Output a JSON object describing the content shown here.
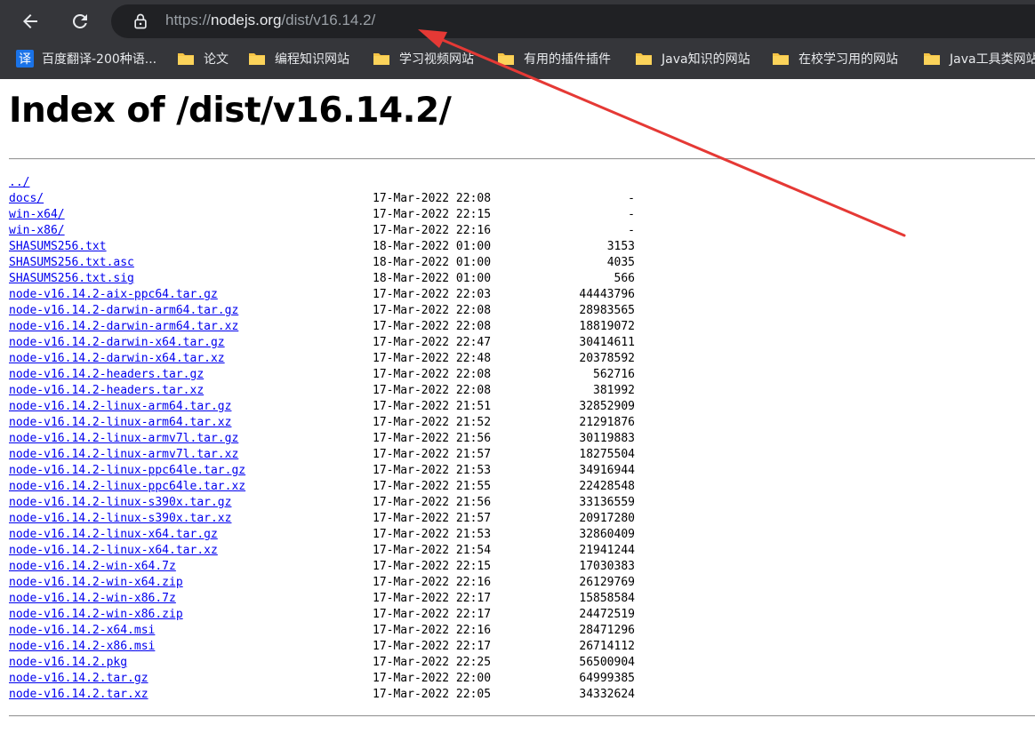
{
  "browser": {
    "url_scheme": "https://",
    "url_host": "nodejs.org",
    "url_path": "/dist/v16.14.2/",
    "icons": {
      "back": "arrow-left-icon",
      "reload": "reload-icon",
      "lock": "lock-icon"
    },
    "bookmarks": [
      {
        "label": "百度翻译-200种语...",
        "icon": "translate-icon",
        "icon_glyph": "译"
      },
      {
        "label": "论文",
        "icon": "folder-icon"
      },
      {
        "label": "编程知识网站",
        "icon": "folder-icon"
      },
      {
        "label": "学习视频网站",
        "icon": "folder-icon"
      },
      {
        "label": "有用的插件插件",
        "icon": "folder-icon"
      },
      {
        "label": "Java知识的网站",
        "icon": "folder-icon"
      },
      {
        "label": "在校学习用的网站",
        "icon": "folder-icon"
      },
      {
        "label": "Java工具类网站",
        "icon": "folder-icon"
      }
    ]
  },
  "page": {
    "title": "Index of /dist/v16.14.2/",
    "entries": [
      {
        "name": "../",
        "date": "",
        "size": ""
      },
      {
        "name": "docs/",
        "date": "17-Mar-2022 22:08",
        "size": "-"
      },
      {
        "name": "win-x64/",
        "date": "17-Mar-2022 22:15",
        "size": "-"
      },
      {
        "name": "win-x86/",
        "date": "17-Mar-2022 22:16",
        "size": "-"
      },
      {
        "name": "SHASUMS256.txt",
        "date": "18-Mar-2022 01:00",
        "size": "3153"
      },
      {
        "name": "SHASUMS256.txt.asc",
        "date": "18-Mar-2022 01:00",
        "size": "4035"
      },
      {
        "name": "SHASUMS256.txt.sig",
        "date": "18-Mar-2022 01:00",
        "size": "566"
      },
      {
        "name": "node-v16.14.2-aix-ppc64.tar.gz",
        "date": "17-Mar-2022 22:03",
        "size": "44443796"
      },
      {
        "name": "node-v16.14.2-darwin-arm64.tar.gz",
        "date": "17-Mar-2022 22:08",
        "size": "28983565"
      },
      {
        "name": "node-v16.14.2-darwin-arm64.tar.xz",
        "date": "17-Mar-2022 22:08",
        "size": "18819072"
      },
      {
        "name": "node-v16.14.2-darwin-x64.tar.gz",
        "date": "17-Mar-2022 22:47",
        "size": "30414611"
      },
      {
        "name": "node-v16.14.2-darwin-x64.tar.xz",
        "date": "17-Mar-2022 22:48",
        "size": "20378592"
      },
      {
        "name": "node-v16.14.2-headers.tar.gz",
        "date": "17-Mar-2022 22:08",
        "size": "562716"
      },
      {
        "name": "node-v16.14.2-headers.tar.xz",
        "date": "17-Mar-2022 22:08",
        "size": "381992"
      },
      {
        "name": "node-v16.14.2-linux-arm64.tar.gz",
        "date": "17-Mar-2022 21:51",
        "size": "32852909"
      },
      {
        "name": "node-v16.14.2-linux-arm64.tar.xz",
        "date": "17-Mar-2022 21:52",
        "size": "21291876"
      },
      {
        "name": "node-v16.14.2-linux-armv7l.tar.gz",
        "date": "17-Mar-2022 21:56",
        "size": "30119883"
      },
      {
        "name": "node-v16.14.2-linux-armv7l.tar.xz",
        "date": "17-Mar-2022 21:57",
        "size": "18275504"
      },
      {
        "name": "node-v16.14.2-linux-ppc64le.tar.gz",
        "date": "17-Mar-2022 21:53",
        "size": "34916944"
      },
      {
        "name": "node-v16.14.2-linux-ppc64le.tar.xz",
        "date": "17-Mar-2022 21:55",
        "size": "22428548"
      },
      {
        "name": "node-v16.14.2-linux-s390x.tar.gz",
        "date": "17-Mar-2022 21:56",
        "size": "33136559"
      },
      {
        "name": "node-v16.14.2-linux-s390x.tar.xz",
        "date": "17-Mar-2022 21:57",
        "size": "20917280"
      },
      {
        "name": "node-v16.14.2-linux-x64.tar.gz",
        "date": "17-Mar-2022 21:53",
        "size": "32860409"
      },
      {
        "name": "node-v16.14.2-linux-x64.tar.xz",
        "date": "17-Mar-2022 21:54",
        "size": "21941244"
      },
      {
        "name": "node-v16.14.2-win-x64.7z",
        "date": "17-Mar-2022 22:15",
        "size": "17030383"
      },
      {
        "name": "node-v16.14.2-win-x64.zip",
        "date": "17-Mar-2022 22:16",
        "size": "26129769"
      },
      {
        "name": "node-v16.14.2-win-x86.7z",
        "date": "17-Mar-2022 22:17",
        "size": "15858584"
      },
      {
        "name": "node-v16.14.2-win-x86.zip",
        "date": "17-Mar-2022 22:17",
        "size": "24472519"
      },
      {
        "name": "node-v16.14.2-x64.msi",
        "date": "17-Mar-2022 22:16",
        "size": "28471296"
      },
      {
        "name": "node-v16.14.2-x86.msi",
        "date": "17-Mar-2022 22:17",
        "size": "26714112"
      },
      {
        "name": "node-v16.14.2.pkg",
        "date": "17-Mar-2022 22:25",
        "size": "56500904"
      },
      {
        "name": "node-v16.14.2.tar.gz",
        "date": "17-Mar-2022 22:00",
        "size": "64999385"
      },
      {
        "name": "node-v16.14.2.tar.xz",
        "date": "17-Mar-2022 22:05",
        "size": "34332624"
      }
    ]
  },
  "colors": {
    "chrome_bg": "#35363a",
    "omnibox_bg": "#202124",
    "link": "#0000ee",
    "annotation_arrow": "#e53935"
  }
}
